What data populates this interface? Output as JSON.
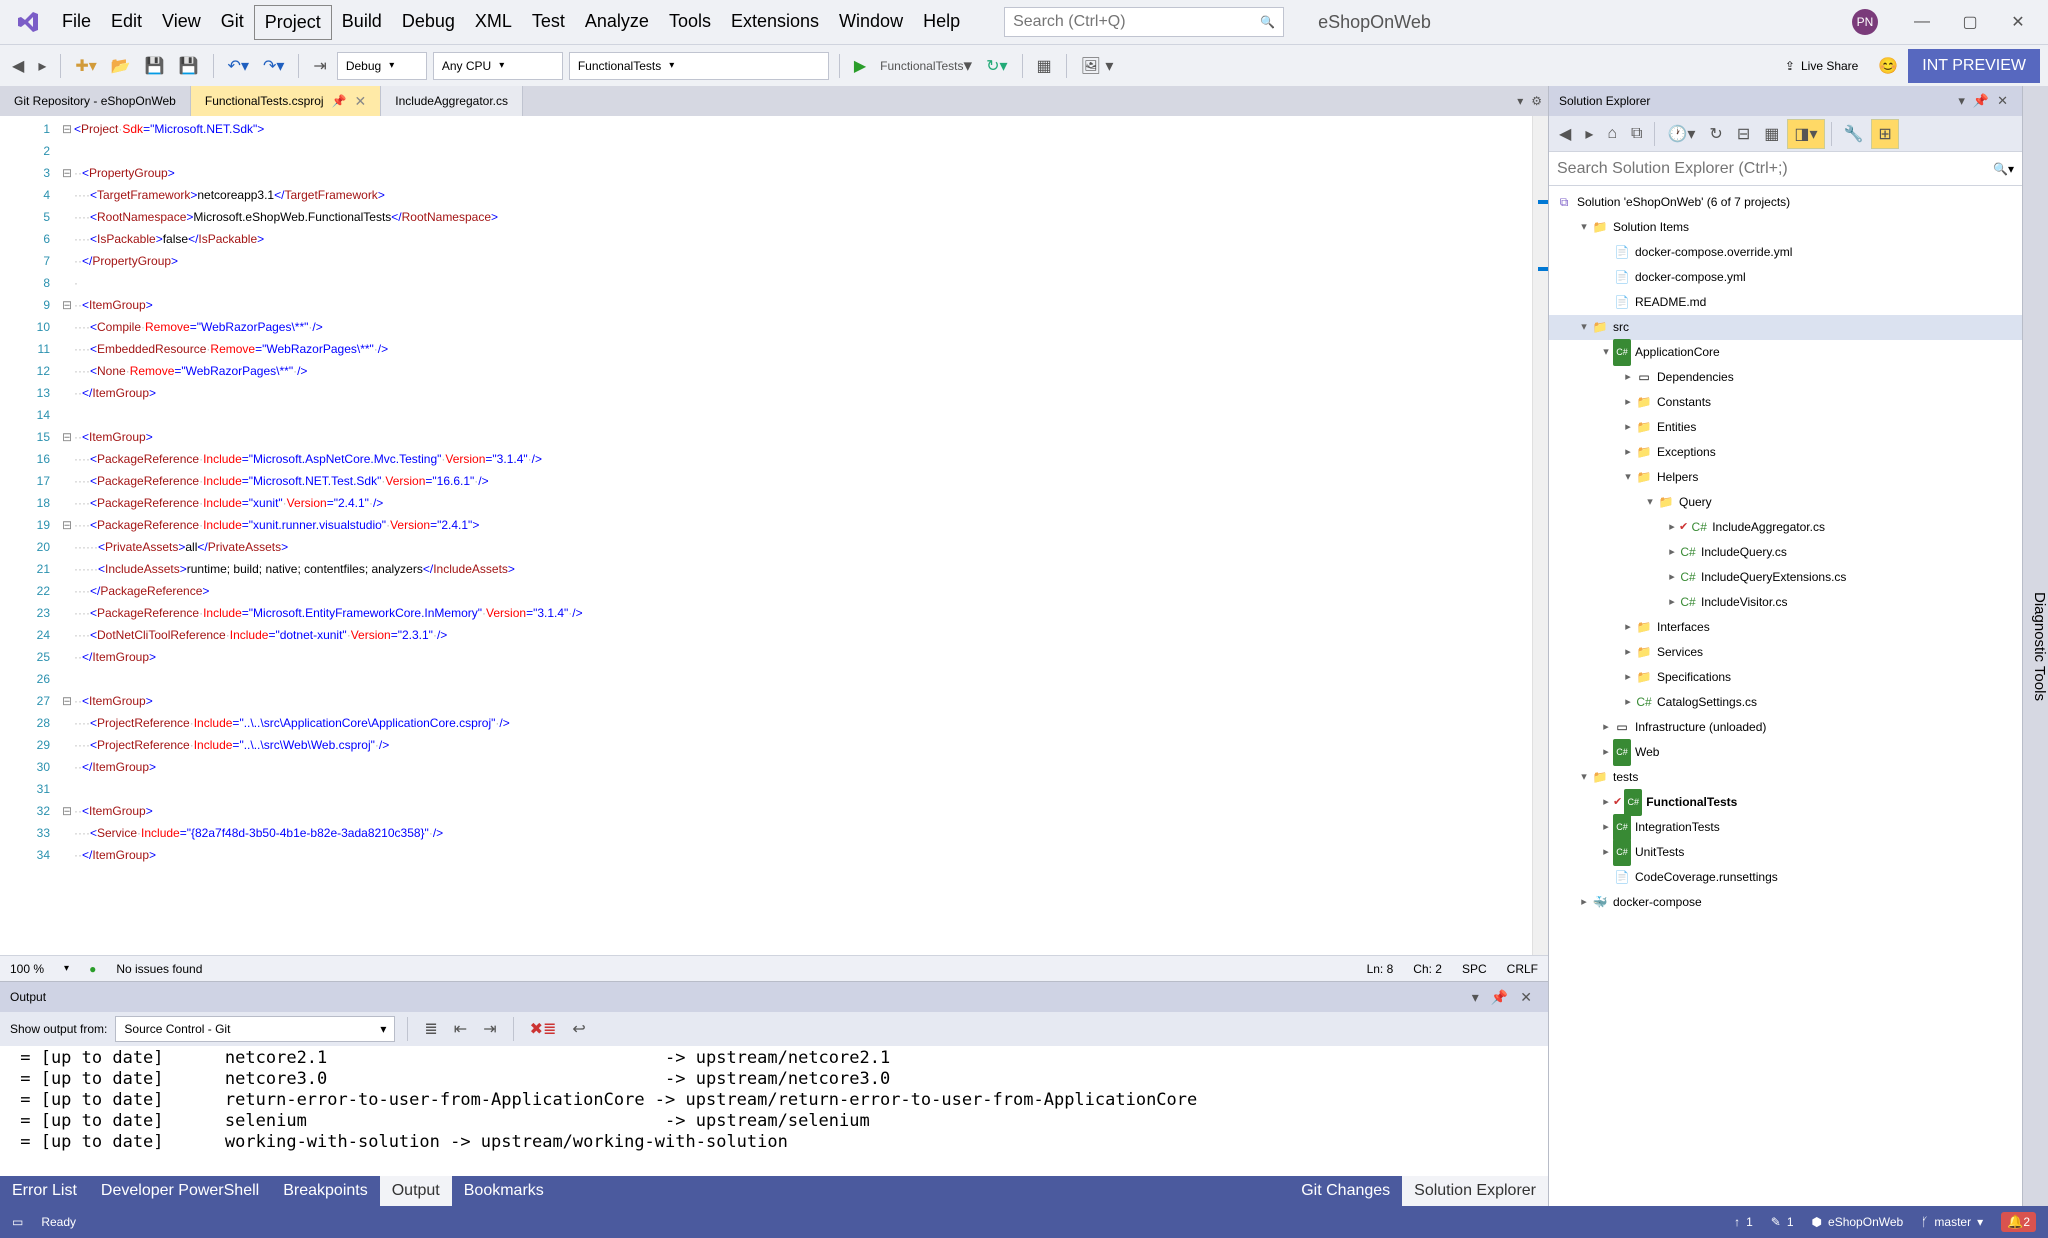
{
  "menu": [
    "File",
    "Edit",
    "View",
    "Git",
    "Project",
    "Build",
    "Debug",
    "XML",
    "Test",
    "Analyze",
    "Tools",
    "Extensions",
    "Window",
    "Help"
  ],
  "menu_boxed_index": 4,
  "search": {
    "placeholder": "Search (Ctrl+Q)"
  },
  "app_title": "eShopOnWeb",
  "avatar": "PN",
  "toolbar": {
    "config": "Debug",
    "platform": "Any CPU",
    "startup": "FunctionalTests",
    "run_target": "FunctionalTests",
    "live_share": "Live Share",
    "int_preview": "INT PREVIEW"
  },
  "tabs": [
    {
      "label": "Git Repository - eShopOnWeb",
      "kind": "git"
    },
    {
      "label": "FunctionalTests.csproj",
      "kind": "active",
      "pinned": true
    },
    {
      "label": "IncludeAggregator.cs",
      "kind": "inactive"
    }
  ],
  "code_lines": [
    {
      "n": 1,
      "fold": "⊟",
      "seg": [
        [
          "p",
          "<"
        ],
        [
          "tag",
          "Project"
        ],
        [
          "d",
          "·"
        ],
        [
          "attr",
          "Sdk"
        ],
        [
          "p",
          "="
        ],
        [
          "str",
          "\"Microsoft.NET.Sdk\""
        ],
        [
          "p",
          ">"
        ]
      ]
    },
    {
      "n": 2,
      "seg": []
    },
    {
      "n": 3,
      "fold": "⊟",
      "seg": [
        [
          "d",
          "··"
        ],
        [
          "p",
          "<"
        ],
        [
          "tag",
          "PropertyGroup"
        ],
        [
          "p",
          ">"
        ]
      ]
    },
    {
      "n": 4,
      "seg": [
        [
          "d",
          "····"
        ],
        [
          "p",
          "<"
        ],
        [
          "tag",
          "TargetFramework"
        ],
        [
          "p",
          ">"
        ],
        [
          "txt",
          "netcoreapp3.1"
        ],
        [
          "p",
          "</"
        ],
        [
          "tag",
          "TargetFramework"
        ],
        [
          "p",
          ">"
        ]
      ]
    },
    {
      "n": 5,
      "seg": [
        [
          "d",
          "····"
        ],
        [
          "p",
          "<"
        ],
        [
          "tag",
          "RootNamespace"
        ],
        [
          "p",
          ">"
        ],
        [
          "txt",
          "Microsoft.eShopWeb.FunctionalTests"
        ],
        [
          "p",
          "</"
        ],
        [
          "tag",
          "RootNamespace"
        ],
        [
          "p",
          ">"
        ]
      ]
    },
    {
      "n": 6,
      "seg": [
        [
          "d",
          "····"
        ],
        [
          "p",
          "<"
        ],
        [
          "tag",
          "IsPackable"
        ],
        [
          "p",
          ">"
        ],
        [
          "txt",
          "false"
        ],
        [
          "p",
          "</"
        ],
        [
          "tag",
          "IsPackable"
        ],
        [
          "p",
          ">"
        ]
      ]
    },
    {
      "n": 7,
      "seg": [
        [
          "d",
          "··"
        ],
        [
          "p",
          "</"
        ],
        [
          "tag",
          "PropertyGroup"
        ],
        [
          "p",
          ">"
        ]
      ]
    },
    {
      "n": 8,
      "seg": [
        [
          "d",
          "·"
        ]
      ]
    },
    {
      "n": 9,
      "fold": "⊟",
      "seg": [
        [
          "d",
          "··"
        ],
        [
          "p",
          "<"
        ],
        [
          "tag",
          "ItemGroup"
        ],
        [
          "p",
          ">"
        ]
      ]
    },
    {
      "n": 10,
      "seg": [
        [
          "d",
          "····"
        ],
        [
          "p",
          "<"
        ],
        [
          "tag",
          "Compile"
        ],
        [
          "d",
          "·"
        ],
        [
          "attr",
          "Remove"
        ],
        [
          "p",
          "="
        ],
        [
          "str",
          "\"WebRazorPages\\**\""
        ],
        [
          "d",
          "·"
        ],
        [
          "p",
          "/>"
        ]
      ]
    },
    {
      "n": 11,
      "seg": [
        [
          "d",
          "····"
        ],
        [
          "p",
          "<"
        ],
        [
          "tag",
          "EmbeddedResource"
        ],
        [
          "d",
          "·"
        ],
        [
          "attr",
          "Remove"
        ],
        [
          "p",
          "="
        ],
        [
          "str",
          "\"WebRazorPages\\**\""
        ],
        [
          "d",
          "·"
        ],
        [
          "p",
          "/>"
        ]
      ]
    },
    {
      "n": 12,
      "seg": [
        [
          "d",
          "····"
        ],
        [
          "p",
          "<"
        ],
        [
          "tag",
          "None"
        ],
        [
          "d",
          "·"
        ],
        [
          "attr",
          "Remove"
        ],
        [
          "p",
          "="
        ],
        [
          "str",
          "\"WebRazorPages\\**\""
        ],
        [
          "d",
          "·"
        ],
        [
          "p",
          "/>"
        ]
      ]
    },
    {
      "n": 13,
      "seg": [
        [
          "d",
          "··"
        ],
        [
          "p",
          "</"
        ],
        [
          "tag",
          "ItemGroup"
        ],
        [
          "p",
          ">"
        ]
      ]
    },
    {
      "n": 14,
      "seg": []
    },
    {
      "n": 15,
      "fold": "⊟",
      "seg": [
        [
          "d",
          "··"
        ],
        [
          "p",
          "<"
        ],
        [
          "tag",
          "ItemGroup"
        ],
        [
          "p",
          ">"
        ]
      ]
    },
    {
      "n": 16,
      "seg": [
        [
          "d",
          "····"
        ],
        [
          "p",
          "<"
        ],
        [
          "tag",
          "PackageReference"
        ],
        [
          "d",
          "·"
        ],
        [
          "attr",
          "Include"
        ],
        [
          "p",
          "="
        ],
        [
          "str",
          "\"Microsoft.AspNetCore.Mvc.Testing\""
        ],
        [
          "d",
          "·"
        ],
        [
          "attr",
          "Version"
        ],
        [
          "p",
          "="
        ],
        [
          "str",
          "\"3.1.4\""
        ],
        [
          "d",
          "·"
        ],
        [
          "p",
          "/>"
        ]
      ]
    },
    {
      "n": 17,
      "seg": [
        [
          "d",
          "····"
        ],
        [
          "p",
          "<"
        ],
        [
          "tag",
          "PackageReference"
        ],
        [
          "d",
          "·"
        ],
        [
          "attr",
          "Include"
        ],
        [
          "p",
          "="
        ],
        [
          "str",
          "\"Microsoft.NET.Test.Sdk\""
        ],
        [
          "d",
          "·"
        ],
        [
          "attr",
          "Version"
        ],
        [
          "p",
          "="
        ],
        [
          "str",
          "\"16.6.1\""
        ],
        [
          "d",
          "·"
        ],
        [
          "p",
          "/>"
        ]
      ]
    },
    {
      "n": 18,
      "seg": [
        [
          "d",
          "····"
        ],
        [
          "p",
          "<"
        ],
        [
          "tag",
          "PackageReference"
        ],
        [
          "d",
          "·"
        ],
        [
          "attr",
          "Include"
        ],
        [
          "p",
          "="
        ],
        [
          "str",
          "\"xunit\""
        ],
        [
          "d",
          "·"
        ],
        [
          "attr",
          "Version"
        ],
        [
          "p",
          "="
        ],
        [
          "str",
          "\"2.4.1\""
        ],
        [
          "d",
          "·"
        ],
        [
          "p",
          "/>"
        ]
      ]
    },
    {
      "n": 19,
      "fold": "⊟",
      "seg": [
        [
          "d",
          "····"
        ],
        [
          "p",
          "<"
        ],
        [
          "tag",
          "PackageReference"
        ],
        [
          "d",
          "·"
        ],
        [
          "attr",
          "Include"
        ],
        [
          "p",
          "="
        ],
        [
          "str",
          "\"xunit.runner.visualstudio\""
        ],
        [
          "d",
          "·"
        ],
        [
          "attr",
          "Version"
        ],
        [
          "p",
          "="
        ],
        [
          "str",
          "\"2.4.1\""
        ],
        [
          "p",
          ">"
        ]
      ]
    },
    {
      "n": 20,
      "seg": [
        [
          "d",
          "······"
        ],
        [
          "p",
          "<"
        ],
        [
          "tag",
          "PrivateAssets"
        ],
        [
          "p",
          ">"
        ],
        [
          "txt",
          "all"
        ],
        [
          "p",
          "</"
        ],
        [
          "tag",
          "PrivateAssets"
        ],
        [
          "p",
          ">"
        ]
      ]
    },
    {
      "n": 21,
      "seg": [
        [
          "d",
          "······"
        ],
        [
          "p",
          "<"
        ],
        [
          "tag",
          "IncludeAssets"
        ],
        [
          "p",
          ">"
        ],
        [
          "txt",
          "runtime; build; native; contentfiles; analyzers"
        ],
        [
          "p",
          "</"
        ],
        [
          "tag",
          "IncludeAssets"
        ],
        [
          "p",
          ">"
        ]
      ]
    },
    {
      "n": 22,
      "seg": [
        [
          "d",
          "····"
        ],
        [
          "p",
          "</"
        ],
        [
          "tag",
          "PackageReference"
        ],
        [
          "p",
          ">"
        ]
      ]
    },
    {
      "n": 23,
      "seg": [
        [
          "d",
          "····"
        ],
        [
          "p",
          "<"
        ],
        [
          "tag",
          "PackageReference"
        ],
        [
          "d",
          "·"
        ],
        [
          "attr",
          "Include"
        ],
        [
          "p",
          "="
        ],
        [
          "str",
          "\"Microsoft.EntityFrameworkCore.InMemory\""
        ],
        [
          "d",
          "·"
        ],
        [
          "attr",
          "Version"
        ],
        [
          "p",
          "="
        ],
        [
          "str",
          "\"3.1.4\""
        ],
        [
          "d",
          "·"
        ],
        [
          "p",
          "/>"
        ]
      ]
    },
    {
      "n": 24,
      "seg": [
        [
          "d",
          "····"
        ],
        [
          "p",
          "<"
        ],
        [
          "tag",
          "DotNetCliToolReference"
        ],
        [
          "d",
          "·"
        ],
        [
          "attr",
          "Include"
        ],
        [
          "p",
          "="
        ],
        [
          "str",
          "\"dotnet-xunit\""
        ],
        [
          "d",
          "·"
        ],
        [
          "attr",
          "Version"
        ],
        [
          "p",
          "="
        ],
        [
          "str",
          "\"2.3.1\""
        ],
        [
          "d",
          "·"
        ],
        [
          "p",
          "/>"
        ]
      ]
    },
    {
      "n": 25,
      "seg": [
        [
          "d",
          "··"
        ],
        [
          "p",
          "</"
        ],
        [
          "tag",
          "ItemGroup"
        ],
        [
          "p",
          ">"
        ]
      ]
    },
    {
      "n": 26,
      "seg": []
    },
    {
      "n": 27,
      "fold": "⊟",
      "seg": [
        [
          "d",
          "··"
        ],
        [
          "p",
          "<"
        ],
        [
          "tag",
          "ItemGroup"
        ],
        [
          "p",
          ">"
        ]
      ]
    },
    {
      "n": 28,
      "seg": [
        [
          "d",
          "····"
        ],
        [
          "p",
          "<"
        ],
        [
          "tag",
          "ProjectReference"
        ],
        [
          "d",
          "·"
        ],
        [
          "attr",
          "Include"
        ],
        [
          "p",
          "="
        ],
        [
          "str",
          "\"..\\..\\src\\ApplicationCore\\ApplicationCore.csproj\""
        ],
        [
          "d",
          "·"
        ],
        [
          "p",
          "/>"
        ]
      ]
    },
    {
      "n": 29,
      "seg": [
        [
          "d",
          "····"
        ],
        [
          "p",
          "<"
        ],
        [
          "tag",
          "ProjectReference"
        ],
        [
          "d",
          "·"
        ],
        [
          "attr",
          "Include"
        ],
        [
          "p",
          "="
        ],
        [
          "str",
          "\"..\\..\\src\\Web\\Web.csproj\""
        ],
        [
          "d",
          "·"
        ],
        [
          "p",
          "/>"
        ]
      ]
    },
    {
      "n": 30,
      "seg": [
        [
          "d",
          "··"
        ],
        [
          "p",
          "</"
        ],
        [
          "tag",
          "ItemGroup"
        ],
        [
          "p",
          ">"
        ]
      ]
    },
    {
      "n": 31,
      "seg": []
    },
    {
      "n": 32,
      "fold": "⊟",
      "seg": [
        [
          "d",
          "··"
        ],
        [
          "p",
          "<"
        ],
        [
          "tag",
          "ItemGroup"
        ],
        [
          "p",
          ">"
        ]
      ]
    },
    {
      "n": 33,
      "seg": [
        [
          "d",
          "····"
        ],
        [
          "p",
          "<"
        ],
        [
          "tag",
          "Service"
        ],
        [
          "d",
          "·"
        ],
        [
          "attr",
          "Include"
        ],
        [
          "p",
          "="
        ],
        [
          "str",
          "\"{82a7f48d-3b50-4b1e-b82e-3ada8210c358}\""
        ],
        [
          "d",
          "·"
        ],
        [
          "p",
          "/>"
        ]
      ]
    },
    {
      "n": 34,
      "seg": [
        [
          "d",
          "··"
        ],
        [
          "p",
          "</"
        ],
        [
          "tag",
          "ItemGroup"
        ],
        [
          "p",
          ">"
        ]
      ]
    }
  ],
  "editor_status": {
    "zoom": "100 %",
    "issues": "No issues found",
    "ln": "Ln: 8",
    "ch": "Ch: 2",
    "ins": "SPC",
    "eol": "CRLF"
  },
  "output": {
    "title": "Output",
    "from_label": "Show output from:",
    "from_value": "Source Control - Git",
    "lines": [
      " = [up to date]      netcore2.1                                 -> upstream/netcore2.1",
      " = [up to date]      netcore3.0                                 -> upstream/netcore3.0",
      " = [up to date]      return-error-to-user-from-ApplicationCore -> upstream/return-error-to-user-from-ApplicationCore",
      " = [up to date]      selenium                                   -> upstream/selenium",
      " = [up to date]      working-with-solution -> upstream/working-with-solution"
    ]
  },
  "bottom_tabs": [
    "Error List",
    "Developer PowerShell",
    "Breakpoints",
    "Output",
    "Bookmarks"
  ],
  "bottom_tabs_active": 3,
  "right_bottom_tabs": [
    "Git Changes",
    "Solution Explorer"
  ],
  "right_bottom_active": 1,
  "solution": {
    "title": "Solution Explorer",
    "search_placeholder": "Search Solution Explorer (Ctrl+;)",
    "root": "Solution 'eShopOnWeb' (6 of 7 projects)",
    "tree": [
      {
        "d": 1,
        "tw": "▾",
        "ico": "fld",
        "label": "Solution Items"
      },
      {
        "d": 2,
        "tw": "",
        "ico": "file",
        "label": "docker-compose.override.yml"
      },
      {
        "d": 2,
        "tw": "",
        "ico": "file",
        "label": "docker-compose.yml"
      },
      {
        "d": 2,
        "tw": "",
        "ico": "file",
        "label": "README.md"
      },
      {
        "d": 1,
        "tw": "▾",
        "ico": "fld",
        "label": "src",
        "sel": true
      },
      {
        "d": 2,
        "tw": "▾",
        "ico": "prj",
        "label": "ApplicationCore"
      },
      {
        "d": 3,
        "tw": "▸",
        "ico": "dep",
        "label": "Dependencies"
      },
      {
        "d": 3,
        "tw": "▸",
        "ico": "fld",
        "label": "Constants"
      },
      {
        "d": 3,
        "tw": "▸",
        "ico": "fld",
        "label": "Entities"
      },
      {
        "d": 3,
        "tw": "▸",
        "ico": "fld",
        "label": "Exceptions"
      },
      {
        "d": 3,
        "tw": "▾",
        "ico": "fld",
        "label": "Helpers"
      },
      {
        "d": 4,
        "tw": "▾",
        "ico": "fld",
        "label": "Query"
      },
      {
        "d": 5,
        "tw": "▸",
        "ico": "cs",
        "label": "IncludeAggregator.cs",
        "chk": true
      },
      {
        "d": 5,
        "tw": "▸",
        "ico": "cs",
        "label": "IncludeQuery.cs"
      },
      {
        "d": 5,
        "tw": "▸",
        "ico": "cs",
        "label": "IncludeQueryExtensions.cs"
      },
      {
        "d": 5,
        "tw": "▸",
        "ico": "cs",
        "label": "IncludeVisitor.cs"
      },
      {
        "d": 3,
        "tw": "▸",
        "ico": "fld",
        "label": "Interfaces"
      },
      {
        "d": 3,
        "tw": "▸",
        "ico": "fld",
        "label": "Services"
      },
      {
        "d": 3,
        "tw": "▸",
        "ico": "fld",
        "label": "Specifications"
      },
      {
        "d": 3,
        "tw": "▸",
        "ico": "cs",
        "label": "CatalogSettings.cs"
      },
      {
        "d": 2,
        "tw": "▸",
        "ico": "prj-un",
        "label": "Infrastructure (unloaded)"
      },
      {
        "d": 2,
        "tw": "▸",
        "ico": "prj",
        "label": "Web"
      },
      {
        "d": 1,
        "tw": "▾",
        "ico": "fld",
        "label": "tests"
      },
      {
        "d": 2,
        "tw": "▸",
        "ico": "prj",
        "label": "FunctionalTests",
        "bold": true,
        "chk": true
      },
      {
        "d": 2,
        "tw": "▸",
        "ico": "prj",
        "label": "IntegrationTests"
      },
      {
        "d": 2,
        "tw": "▸",
        "ico": "prj",
        "label": "UnitTests"
      },
      {
        "d": 2,
        "tw": "",
        "ico": "file",
        "label": "CodeCoverage.runsettings"
      },
      {
        "d": 1,
        "tw": "▸",
        "ico": "dock",
        "label": "docker-compose"
      }
    ]
  },
  "side_tab": "Diagnostic Tools",
  "statusbar": {
    "ready": "Ready",
    "up": "1",
    "pen": "1",
    "repo": "eShopOnWeb",
    "branch": "master",
    "notif": "2"
  }
}
